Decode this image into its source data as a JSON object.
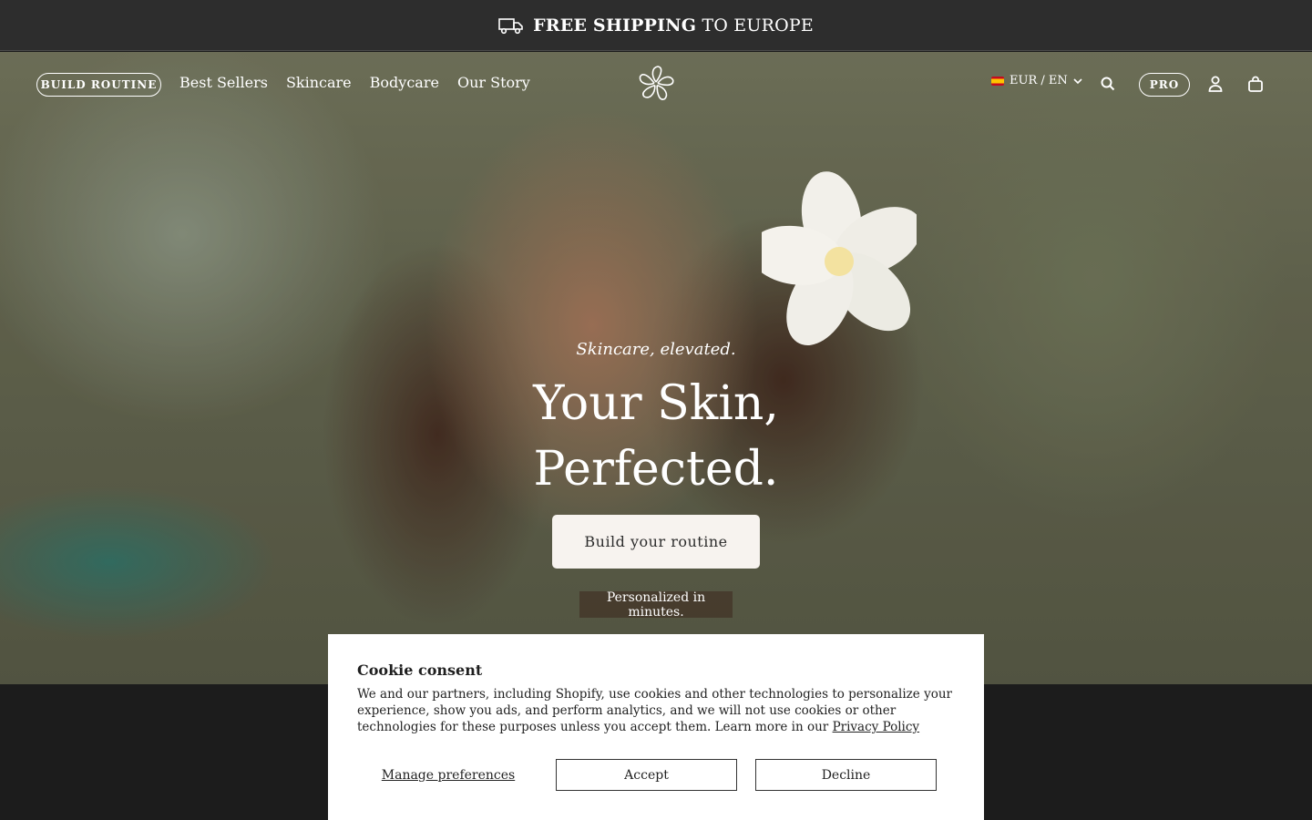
{
  "announcement": {
    "bold": "FREE SHIPPING",
    "rest": " TO EUROPE",
    "icon": "truck-icon"
  },
  "header": {
    "build_routine": "BUILD ROUTINE",
    "nav": [
      "Best Sellers",
      "Skincare",
      "Bodycare",
      "Our Story"
    ],
    "locale": "EUR / EN",
    "pro": "PRO"
  },
  "hero": {
    "tagline": "Skincare, elevated.",
    "headline_1": "Your Skin,",
    "headline_2": "Perfected.",
    "cta": "Build your routine",
    "sub": "Personalized in minutes."
  },
  "cookie": {
    "title": "Cookie consent",
    "body": "We and our partners, including Shopify, use cookies and other technologies to personalize your experience, show you ads, and perform analytics, and we will not use cookies or other technologies for these purposes unless you accept them. Learn more in our ",
    "privacy_link": "Privacy Policy",
    "manage": "Manage preferences",
    "accept": "Accept",
    "decline": "Decline"
  }
}
